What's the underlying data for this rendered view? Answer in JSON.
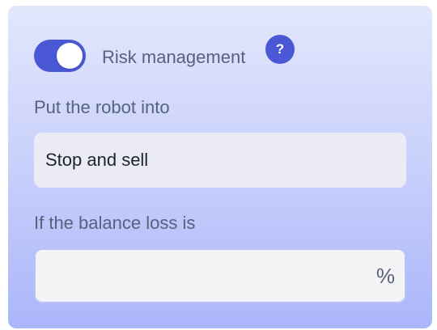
{
  "risk": {
    "toggle_on": true,
    "label": "Risk management",
    "help_icon": "?"
  },
  "action": {
    "label": "Put the robot into",
    "value": "Stop and sell"
  },
  "loss": {
    "label": "If the balance loss is",
    "value": "",
    "unit": "%"
  },
  "colors": {
    "accent": "#4a58d6",
    "text_muted": "#56627e"
  }
}
